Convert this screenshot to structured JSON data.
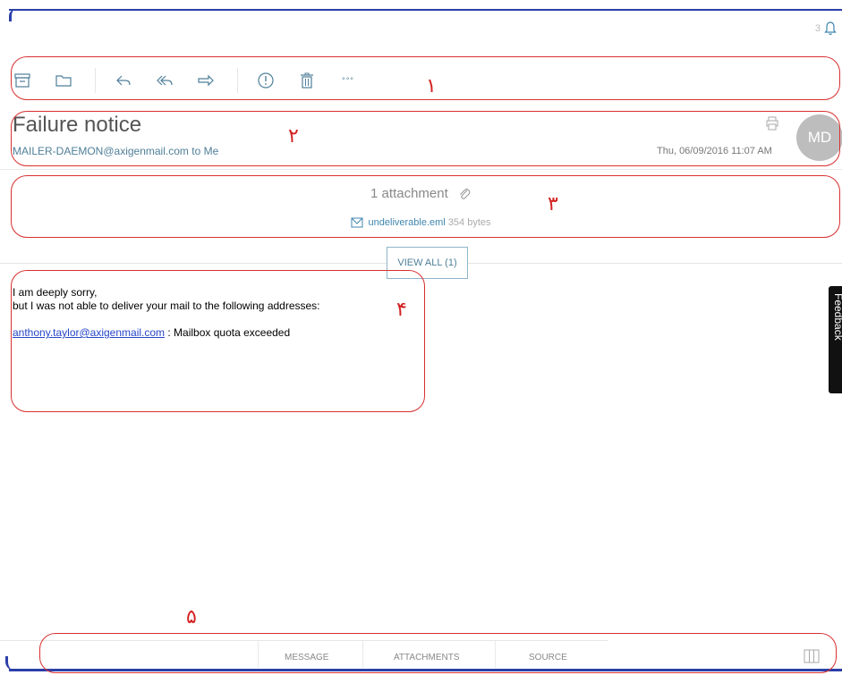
{
  "notifications": {
    "count": "3",
    "icon": "bell-icon"
  },
  "toolbar": {
    "buttons": [
      {
        "name": "archive-icon"
      },
      {
        "name": "folder-icon"
      },
      {
        "name": "reply-icon"
      },
      {
        "name": "reply-all-icon"
      },
      {
        "name": "forward-icon"
      },
      {
        "name": "spam-icon"
      },
      {
        "name": "trash-icon"
      },
      {
        "name": "more-icon",
        "label": "°°°"
      }
    ]
  },
  "message": {
    "subject": "Failure notice",
    "from": "MAILER-DAEMON@axigenmail.com",
    "to": "to Me",
    "date": "Thu, 06/09/2016 11:07 AM",
    "avatar_initials": "MD"
  },
  "attachments": {
    "title": "1 attachment",
    "file_name": "undeliverable.eml",
    "file_size": "354 bytes",
    "view_all_label": "VIEW ALL (1)"
  },
  "body": {
    "line1": "I am deeply sorry,",
    "line2": "but I was not able to deliver your mail to the following addresses:",
    "link": "anthony.taylor@axigenmail.com",
    "link_suffix": " : Mailbox quota exceeded"
  },
  "feedback_label": "Feedback",
  "tabs": {
    "message": "MESSAGE",
    "attachments": "ATTACHMENTS",
    "source": "SOURCE"
  },
  "annotations": [
    "١",
    "٢",
    "٣",
    "۴",
    "۵"
  ],
  "colors": {
    "accent": "#4f7f99",
    "link": "#2646c7",
    "annotation": "#d83030",
    "frame": "#2b3fa8"
  }
}
